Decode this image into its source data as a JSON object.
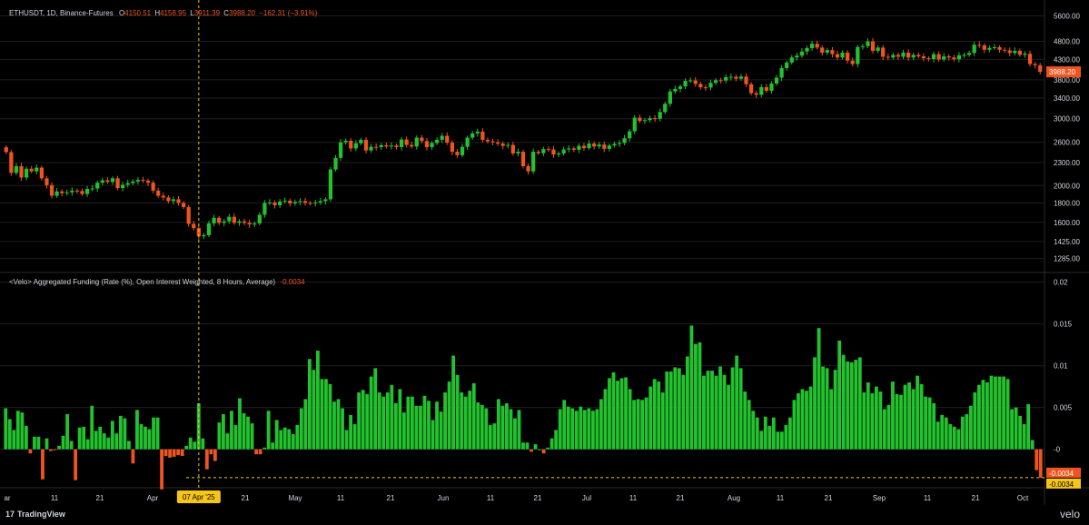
{
  "header": {
    "symbol": "ETHUSDT, 1D, Binance-Futures",
    "o_label": "O",
    "o_value": "4150.51",
    "h_label": "H",
    "h_value": "4158.95",
    "l_label": "L",
    "l_value": "3911.39",
    "c_label": "C",
    "c_value": "3988.20",
    "change": "−162.31 (−3.91%)"
  },
  "funding": {
    "title": "<Velo> Aggregated Funding (Rate (%), Open Interest Weighted, 8 Hours, Average)",
    "current": "-0.0034"
  },
  "footer": {
    "brand": "TradingView",
    "watermark": "velo"
  },
  "colors": {
    "up": "#22c22e",
    "down": "#f0541e",
    "crosshair": "#f5c518",
    "bg": "#000000",
    "grid": "#1e1e22"
  },
  "crosshair_label": "07 Apr '25",
  "chart_data": [
    {
      "type": "candlestick",
      "title": "ETHUSDT, 1D, Binance-Futures",
      "scale": "log",
      "ylim": [
        1200,
        5900
      ],
      "y_ticks": [
        "5600.00",
        "4800.00",
        "4300.00",
        "3800.00",
        "3400.00",
        "3000.00",
        "2600.00",
        "2300.00",
        "2000.00",
        "1800.00",
        "1600.00",
        "1425.00",
        "1285.00"
      ],
      "last_price_label": "3988.20",
      "x_ticks": [
        "ar",
        "11",
        "21",
        "Apr",
        "11",
        "21",
        "May",
        "11",
        "21",
        "Jun",
        "11",
        "21",
        "Jul",
        "11",
        "21",
        "Aug",
        "11",
        "21",
        "Sep",
        "11",
        "21",
        "Oct"
      ],
      "close": [
        2450,
        2160,
        2250,
        2100,
        2215,
        2180,
        2230,
        2090,
        2005,
        1880,
        1930,
        1910,
        1920,
        1940,
        1935,
        1900,
        1960,
        1965,
        2035,
        2065,
        2045,
        2090,
        1970,
        2010,
        2030,
        2050,
        2070,
        2060,
        2035,
        1940,
        1880,
        1860,
        1820,
        1840,
        1800,
        1755,
        1585,
        1545,
        1470,
        1480,
        1590,
        1645,
        1595,
        1610,
        1655,
        1595,
        1610,
        1595,
        1580,
        1590,
        1675,
        1800,
        1805,
        1775,
        1815,
        1825,
        1795,
        1810,
        1820,
        1800,
        1795,
        1805,
        1820,
        1840,
        2205,
        2365,
        2600,
        2625,
        2505,
        2585,
        2640,
        2475,
        2530,
        2525,
        2555,
        2535,
        2550,
        2525,
        2645,
        2560,
        2535,
        2675,
        2620,
        2525,
        2590,
        2640,
        2705,
        2595,
        2455,
        2405,
        2530,
        2675,
        2745,
        2775,
        2640,
        2615,
        2600,
        2580,
        2545,
        2560,
        2430,
        2455,
        2250,
        2180,
        2455,
        2435,
        2495,
        2490,
        2415,
        2430,
        2490,
        2505,
        2485,
        2545,
        2510,
        2580,
        2535,
        2565,
        2500,
        2550,
        2575,
        2590,
        2665,
        2780,
        3020,
        2960,
        2975,
        3010,
        3000,
        3125,
        3285,
        3540,
        3595,
        3650,
        3775,
        3785,
        3705,
        3630,
        3625,
        3730,
        3790,
        3780,
        3860,
        3870,
        3825,
        3875,
        3700,
        3505,
        3470,
        3635,
        3555,
        3715,
        3850,
        4080,
        4220,
        4350,
        4400,
        4510,
        4605,
        4730,
        4620,
        4480,
        4550,
        4440,
        4350,
        4480,
        4270,
        4180,
        4635,
        4660,
        4795,
        4530,
        4620,
        4370,
        4350,
        4420,
        4370,
        4480,
        4350,
        4420,
        4380,
        4330,
        4310,
        4440,
        4300,
        4380,
        4350,
        4305,
        4410,
        4420,
        4470,
        4700,
        4680,
        4560,
        4610,
        4630,
        4560,
        4540,
        4470,
        4530,
        4420,
        4450,
        4180,
        4150,
        3988
      ]
    },
    {
      "type": "bar",
      "title": "<Velo> Aggregated Funding (Rate (%), Open Interest Weighted, 8 Hours, Average)",
      "ylim": [
        -0.0045,
        0.0205
      ],
      "y_ticks": [
        "0.02",
        "0.015",
        "0.01",
        "0.005",
        "-0"
      ],
      "last_value_label": "-0.0034",
      "reference_line": -0.0034,
      "values": [
        0.0049,
        0.0036,
        0.0023,
        0.0046,
        0.0044,
        0.0028,
        -0.0005,
        0.0015,
        0.0015,
        -0.0036,
        0.0013,
        -0.0002,
        -0.0001,
        0.0004,
        0.0016,
        0.0042,
        0.001,
        -0.0037,
        0.0026,
        0.0027,
        0.0012,
        0.0052,
        0.0022,
        0.0027,
        0.0019,
        0.0014,
        0.0034,
        0.0019,
        0.004,
        0.0037,
        0.001,
        -0.0017,
        0.0047,
        0.003,
        0.0027,
        0.0024,
        0.0038,
        0.0038,
        -0.0048,
        -0.0008,
        -0.001,
        -0.0009,
        -0.0007,
        -0.0008,
        0.0004,
        0.0014,
        0.0009,
        0.0055,
        0.0013,
        -0.0024,
        -0.0006,
        -0.0014,
        0.0032,
        0.0042,
        0.0019,
        0.0046,
        0.0029,
        0.0061,
        0.0043,
        0.0039,
        0.0031,
        -0.0006,
        -0.0006,
        0.0002,
        0.0046,
        0.0008,
        0.0035,
        0.0023,
        0.0026,
        0.0024,
        0.0018,
        0.0029,
        0.0049,
        0.006,
        0.0108,
        0.0095,
        0.0118,
        0.0084,
        0.0084,
        0.0078,
        0.0057,
        0.006,
        0.0049,
        0.0023,
        0.0041,
        0.003,
        0.0068,
        0.0071,
        0.0066,
        0.0087,
        0.0097,
        0.0068,
        0.0063,
        0.0068,
        0.0077,
        0.0055,
        0.0072,
        0.0044,
        0.0063,
        0.0063,
        0.0052,
        0.0052,
        0.0064,
        0.0058,
        0.0035,
        0.0057,
        0.0045,
        0.0068,
        0.0081,
        0.0112,
        0.0089,
        0.0068,
        0.0063,
        0.007,
        0.0079,
        0.0056,
        0.0053,
        0.0049,
        0.0029,
        0.0031,
        0.006,
        0.0052,
        0.0055,
        0.0048,
        0.0037,
        0.0047,
        0.0008,
        0.0008,
        -0.0003,
        0.0006,
        0.0,
        -0.0005,
        0.0002,
        0.0013,
        0.0023,
        0.0048,
        0.0059,
        0.0051,
        0.0049,
        0.0046,
        0.0051,
        0.0047,
        0.0049,
        0.0046,
        0.0048,
        0.006,
        0.0072,
        0.0085,
        0.0092,
        0.0082,
        0.0085,
        0.0086,
        0.0072,
        0.0059,
        0.006,
        0.0059,
        0.0062,
        0.0075,
        0.0084,
        0.0081,
        0.0068,
        0.0093,
        0.0093,
        0.0098,
        0.0097,
        0.0089,
        0.0111,
        0.0148,
        0.0126,
        0.0128,
        0.0088,
        0.0094,
        0.0094,
        0.0088,
        0.0099,
        0.0089,
        0.0077,
        0.0098,
        0.0112,
        0.0097,
        0.0069,
        0.0059,
        0.0046,
        0.0038,
        0.0022,
        0.0039,
        0.0028,
        0.0038,
        0.0021,
        0.0021,
        0.0029,
        0.0038,
        0.0059,
        0.0067,
        0.0072,
        0.007,
        0.0075,
        0.011,
        0.0145,
        0.0099,
        0.0097,
        0.0072,
        0.0095,
        0.013,
        0.0113,
        0.0105,
        0.0104,
        0.0107,
        0.011,
        0.0068,
        0.008,
        0.0067,
        0.0075,
        0.0069,
        0.0048,
        0.0053,
        0.0081,
        0.0066,
        0.0065,
        0.0077,
        0.008,
        0.0072,
        0.0088,
        0.0078,
        0.0063,
        0.0062,
        0.0055,
        0.0033,
        0.0041,
        0.0038,
        0.003,
        0.0027,
        0.0024,
        0.0039,
        0.0042,
        0.0052,
        0.0068,
        0.0077,
        0.0083,
        0.008,
        0.0088,
        0.0087,
        0.0087,
        0.0087,
        0.0084,
        0.0048,
        0.005,
        0.004,
        0.003,
        0.0054,
        0.0011,
        -0.0025,
        -0.0034
      ]
    }
  ]
}
